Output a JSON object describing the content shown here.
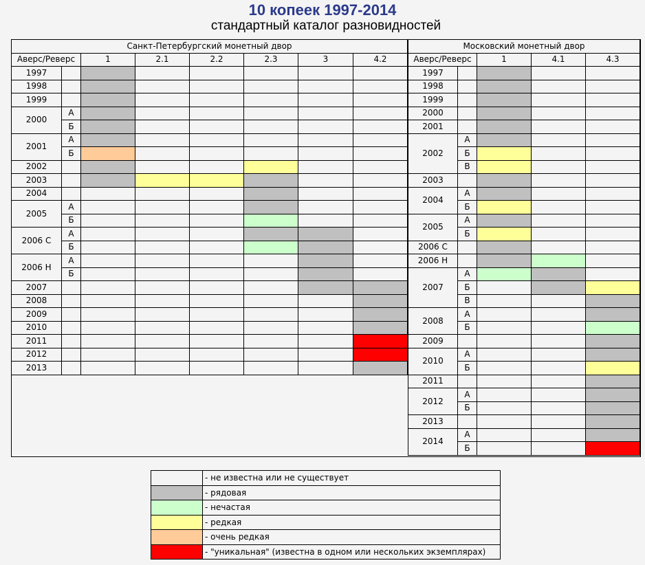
{
  "title": "10 копеек 1997-2014",
  "subtitle": "стандартный каталог разновидностей",
  "colors": {
    "none": "#f4f4f4",
    "common": "#c0c0c0",
    "uncommon": "#ccffcc",
    "rare": "#ffff99",
    "very_rare": "#ffcc99",
    "unique": "#ff0000"
  },
  "spb": {
    "mint": "Санкт-Петербургский монетный двор",
    "corner": "Аверс/Реверс",
    "columns": [
      "1",
      "2.1",
      "2.2",
      "2.3",
      "3",
      "4.2"
    ],
    "years": [
      {
        "year": "1997",
        "rows": [
          {
            "sub": "",
            "cells": [
              "common",
              "",
              "",
              "",
              "",
              ""
            ]
          }
        ]
      },
      {
        "year": "1998",
        "rows": [
          {
            "sub": "",
            "cells": [
              "common",
              "",
              "",
              "",
              "",
              ""
            ]
          }
        ]
      },
      {
        "year": "1999",
        "rows": [
          {
            "sub": "",
            "cells": [
              "common",
              "",
              "",
              "",
              "",
              ""
            ]
          }
        ]
      },
      {
        "year": "2000",
        "rows": [
          {
            "sub": "А",
            "cells": [
              "common",
              "",
              "",
              "",
              "",
              ""
            ]
          },
          {
            "sub": "Б",
            "cells": [
              "common",
              "",
              "",
              "",
              "",
              ""
            ]
          }
        ]
      },
      {
        "year": "2001",
        "rows": [
          {
            "sub": "А",
            "cells": [
              "common",
              "",
              "",
              "",
              "",
              ""
            ]
          },
          {
            "sub": "Б",
            "cells": [
              "very_rare",
              "",
              "",
              "",
              "",
              ""
            ]
          }
        ]
      },
      {
        "year": "2002",
        "rows": [
          {
            "sub": "",
            "cells": [
              "common",
              "",
              "",
              "rare",
              "",
              ""
            ]
          }
        ]
      },
      {
        "year": "2003",
        "rows": [
          {
            "sub": "",
            "cells": [
              "common",
              "rare",
              "rare",
              "common",
              "",
              ""
            ]
          }
        ]
      },
      {
        "year": "2004",
        "rows": [
          {
            "sub": "",
            "cells": [
              "",
              "",
              "",
              "common",
              "",
              ""
            ]
          }
        ]
      },
      {
        "year": "2005",
        "rows": [
          {
            "sub": "А",
            "cells": [
              "",
              "",
              "",
              "common",
              "",
              ""
            ]
          },
          {
            "sub": "Б",
            "cells": [
              "",
              "",
              "",
              "uncommon",
              "",
              ""
            ]
          }
        ]
      },
      {
        "year": "2006 С",
        "rows": [
          {
            "sub": "А",
            "cells": [
              "",
              "",
              "",
              "common",
              "common",
              ""
            ]
          },
          {
            "sub": "Б",
            "cells": [
              "",
              "",
              "",
              "uncommon",
              "common",
              ""
            ]
          }
        ]
      },
      {
        "year": "2006 Н",
        "rows": [
          {
            "sub": "А",
            "cells": [
              "",
              "",
              "",
              "",
              "common",
              ""
            ]
          },
          {
            "sub": "Б",
            "cells": [
              "",
              "",
              "",
              "",
              "common",
              ""
            ]
          }
        ]
      },
      {
        "year": "2007",
        "rows": [
          {
            "sub": "",
            "cells": [
              "",
              "",
              "",
              "",
              "common",
              "common"
            ]
          }
        ]
      },
      {
        "year": "2008",
        "rows": [
          {
            "sub": "",
            "cells": [
              "",
              "",
              "",
              "",
              "",
              "common"
            ]
          }
        ]
      },
      {
        "year": "2009",
        "rows": [
          {
            "sub": "",
            "cells": [
              "",
              "",
              "",
              "",
              "",
              "common"
            ]
          }
        ]
      },
      {
        "year": "2010",
        "rows": [
          {
            "sub": "",
            "cells": [
              "",
              "",
              "",
              "",
              "",
              "common"
            ]
          }
        ]
      },
      {
        "year": "2011",
        "rows": [
          {
            "sub": "",
            "cells": [
              "",
              "",
              "",
              "",
              "",
              "unique"
            ]
          }
        ]
      },
      {
        "year": "2012",
        "rows": [
          {
            "sub": "",
            "cells": [
              "",
              "",
              "",
              "",
              "",
              "unique"
            ]
          }
        ]
      },
      {
        "year": "2013",
        "rows": [
          {
            "sub": "",
            "cells": [
              "",
              "",
              "",
              "",
              "",
              "common"
            ]
          }
        ]
      }
    ]
  },
  "msk": {
    "mint": "Московский монетный двор",
    "corner": "Аверс/Реверс",
    "columns": [
      "1",
      "4.1",
      "4.3"
    ],
    "years": [
      {
        "year": "1997",
        "rows": [
          {
            "sub": "",
            "cells": [
              "common",
              "",
              ""
            ]
          }
        ]
      },
      {
        "year": "1998",
        "rows": [
          {
            "sub": "",
            "cells": [
              "common",
              "",
              ""
            ]
          }
        ]
      },
      {
        "year": "1999",
        "rows": [
          {
            "sub": "",
            "cells": [
              "common",
              "",
              ""
            ]
          }
        ]
      },
      {
        "year": "2000",
        "rows": [
          {
            "sub": "",
            "cells": [
              "common",
              "",
              ""
            ]
          }
        ]
      },
      {
        "year": "2001",
        "rows": [
          {
            "sub": "",
            "cells": [
              "common",
              "",
              ""
            ]
          }
        ]
      },
      {
        "year": "2002",
        "rows": [
          {
            "sub": "А",
            "cells": [
              "common",
              "",
              ""
            ]
          },
          {
            "sub": "Б",
            "cells": [
              "rare",
              "",
              ""
            ]
          },
          {
            "sub": "В",
            "cells": [
              "rare",
              "",
              ""
            ]
          }
        ]
      },
      {
        "year": "2003",
        "rows": [
          {
            "sub": "",
            "cells": [
              "common",
              "",
              ""
            ]
          }
        ]
      },
      {
        "year": "2004",
        "rows": [
          {
            "sub": "А",
            "cells": [
              "common",
              "",
              ""
            ]
          },
          {
            "sub": "Б",
            "cells": [
              "rare",
              "",
              ""
            ]
          }
        ]
      },
      {
        "year": "2005",
        "rows": [
          {
            "sub": "А",
            "cells": [
              "common",
              "",
              ""
            ]
          },
          {
            "sub": "Б",
            "cells": [
              "rare",
              "",
              ""
            ]
          }
        ]
      },
      {
        "year": "2006 С",
        "rows": [
          {
            "sub": "",
            "cells": [
              "common",
              "",
              ""
            ]
          }
        ]
      },
      {
        "year": "2006 Н",
        "rows": [
          {
            "sub": "",
            "cells": [
              "common",
              "uncommon",
              ""
            ]
          }
        ]
      },
      {
        "year": "2007",
        "rows": [
          {
            "sub": "А",
            "cells": [
              "uncommon",
              "common",
              ""
            ]
          },
          {
            "sub": "Б",
            "cells": [
              "",
              "common",
              "rare"
            ]
          },
          {
            "sub": "В",
            "cells": [
              "",
              "",
              "common"
            ]
          }
        ]
      },
      {
        "year": "2008",
        "rows": [
          {
            "sub": "А",
            "cells": [
              "",
              "",
              "common"
            ]
          },
          {
            "sub": "Б",
            "cells": [
              "",
              "",
              "uncommon"
            ]
          }
        ]
      },
      {
        "year": "2009",
        "rows": [
          {
            "sub": "",
            "cells": [
              "",
              "",
              "common"
            ]
          }
        ]
      },
      {
        "year": "2010",
        "rows": [
          {
            "sub": "А",
            "cells": [
              "",
              "",
              "common"
            ]
          },
          {
            "sub": "Б",
            "cells": [
              "",
              "",
              "rare"
            ]
          }
        ]
      },
      {
        "year": "2011",
        "rows": [
          {
            "sub": "",
            "cells": [
              "",
              "",
              "common"
            ]
          }
        ]
      },
      {
        "year": "2012",
        "rows": [
          {
            "sub": "А",
            "cells": [
              "",
              "",
              "common"
            ]
          },
          {
            "sub": "Б",
            "cells": [
              "",
              "",
              "common"
            ]
          }
        ]
      },
      {
        "year": "2013",
        "rows": [
          {
            "sub": "",
            "cells": [
              "",
              "",
              "common"
            ]
          }
        ]
      },
      {
        "year": "2014",
        "rows": [
          {
            "sub": "А",
            "cells": [
              "",
              "",
              "common"
            ]
          },
          {
            "sub": "Б",
            "cells": [
              "",
              "",
              "unique"
            ]
          }
        ]
      }
    ]
  },
  "legend": [
    {
      "key": "none",
      "text": "- не известна или не существует"
    },
    {
      "key": "common",
      "text": "- рядовая"
    },
    {
      "key": "uncommon",
      "text": "- нечастая"
    },
    {
      "key": "rare",
      "text": "- редкая"
    },
    {
      "key": "very_rare",
      "text": "- очень редкая"
    },
    {
      "key": "unique",
      "text": "- \"уникальная\" (известна в одном или нескольких экземплярах)"
    }
  ]
}
